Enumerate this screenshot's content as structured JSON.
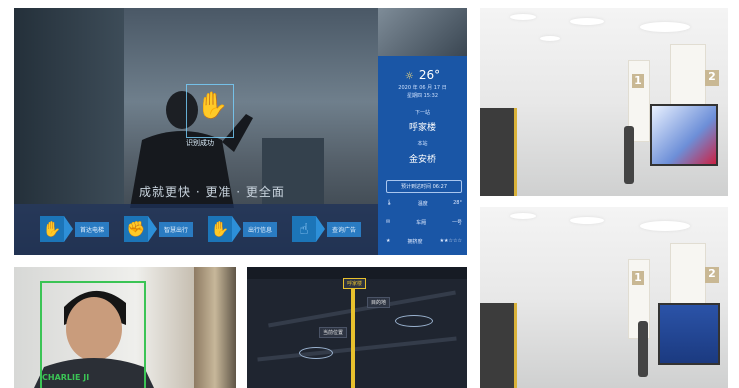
{
  "main_panel": {
    "scan_label": "识别成功",
    "tagline": "成就更快 · 更准 · 更全面",
    "gestures": [
      {
        "icon": "hand-palm-icon",
        "label": "首达电梯"
      },
      {
        "icon": "hand-grab-icon",
        "label": "智慧出行"
      },
      {
        "icon": "hand-wave-icon",
        "label": "出行信息"
      },
      {
        "icon": "hand-point-icon",
        "label": "查询广告"
      }
    ]
  },
  "side_info": {
    "temperature": "26°",
    "date": "2020 年 06 月 17 日",
    "time_line": "星期四 15:32",
    "next_label": "下一站",
    "next_station": "呼家楼",
    "current_label": "本站",
    "current_station": "金安桥",
    "time_box": "预计到达时间 06:27",
    "rows": [
      {
        "icon": "thermometer-icon",
        "label": "温度",
        "value": "28°"
      },
      {
        "icon": "mail-icon",
        "label": "车厢",
        "value": "一号"
      },
      {
        "icon": "star-icon",
        "label": "拥挤度",
        "value": "★★☆☆☆"
      }
    ]
  },
  "metro_top": {
    "signs": [
      "1",
      "2"
    ]
  },
  "metro_bottom": {
    "signs": [
      "1",
      "2"
    ]
  },
  "face_panel": {
    "label": "CHARLIE JI"
  },
  "map_panel": {
    "header_left": "",
    "header_right": "",
    "destination": "呼家楼",
    "labels": [
      "目的地",
      "当前位置"
    ]
  },
  "colors": {
    "accent_blue": "#1a56a6",
    "scan_cyan": "#43c3ff",
    "face_green": "#3bc455",
    "route_yellow": "#e8c12d"
  }
}
